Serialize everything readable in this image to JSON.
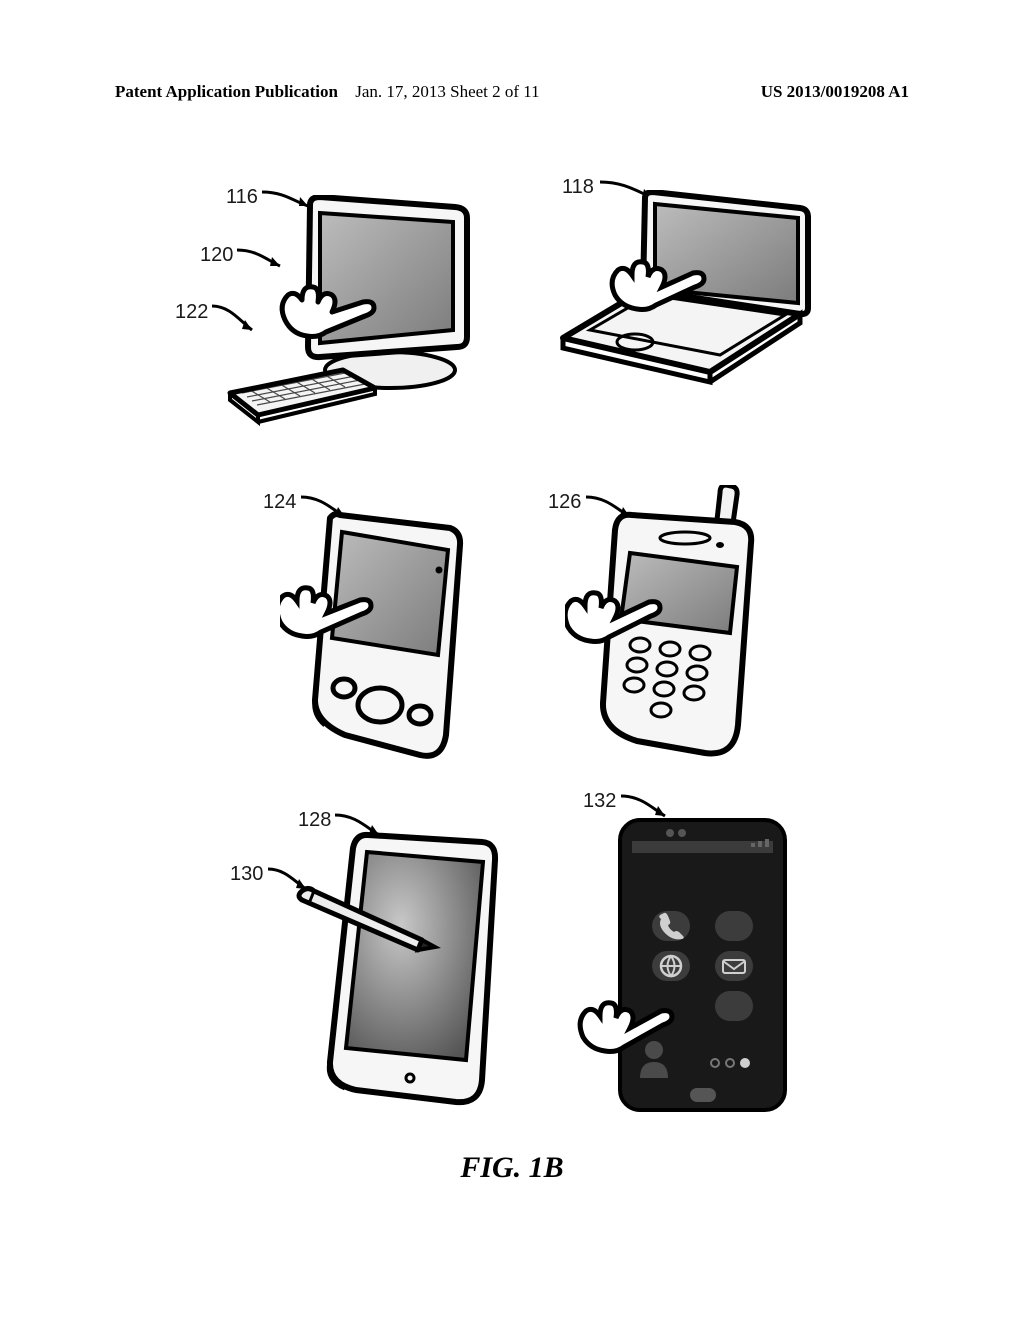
{
  "header": {
    "left": "Patent Application Publication",
    "mid": "Jan. 17, 2013  Sheet 2 of 11",
    "right": "US 2013/0019208 A1"
  },
  "figure": {
    "caption": "FIG. 1B"
  },
  "labels": {
    "l116": "116",
    "l120": "120",
    "l122": "122",
    "l118": "118",
    "l124": "124",
    "l126": "126",
    "l128": "128",
    "l130": "130",
    "l132": "132"
  }
}
